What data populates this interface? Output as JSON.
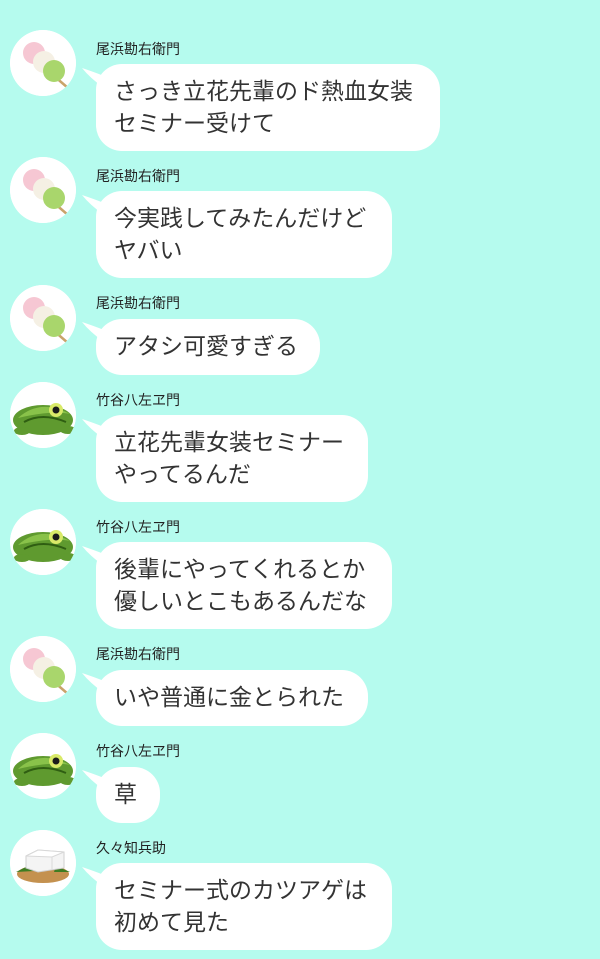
{
  "chat": {
    "background": "#b5fbee",
    "messages": [
      {
        "sender": "尾浜勘右衛門",
        "avatar": "dango-icon",
        "lines": [
          "さっき立花先輩のド熱血女装",
          "セミナー受けて"
        ]
      },
      {
        "sender": "尾浜勘右衛門",
        "avatar": "dango-icon",
        "lines": [
          "今実践してみたんだけど",
          "ヤバい"
        ]
      },
      {
        "sender": "尾浜勘右衛門",
        "avatar": "dango-icon",
        "lines": [
          "アタシ可愛すぎる"
        ]
      },
      {
        "sender": "竹谷八左ヱ門",
        "avatar": "frog-icon",
        "lines": [
          "立花先輩女装セミナー",
          "やってるんだ"
        ]
      },
      {
        "sender": "竹谷八左ヱ門",
        "avatar": "frog-icon",
        "lines": [
          "後輩にやってくれるとか",
          "優しいとこもあるんだな"
        ]
      },
      {
        "sender": "尾浜勘右衛門",
        "avatar": "dango-icon",
        "lines": [
          "いや普通に金とられた"
        ]
      },
      {
        "sender": "竹谷八左ヱ門",
        "avatar": "frog-icon",
        "lines": [
          "草"
        ]
      },
      {
        "sender": "久々知兵助",
        "avatar": "tofu-icon",
        "lines": [
          "セミナー式のカツアゲは",
          "初めて見た"
        ]
      }
    ]
  }
}
